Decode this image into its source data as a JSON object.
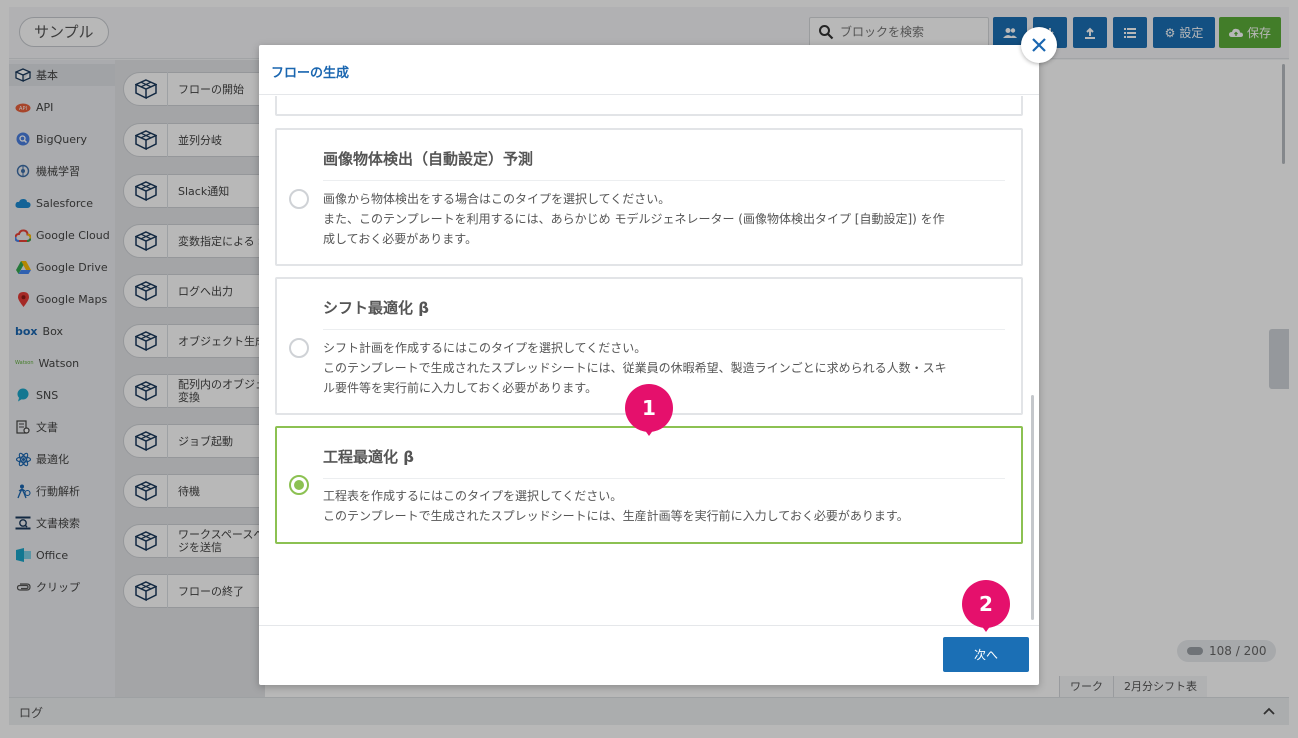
{
  "app": {
    "title": "サンプル"
  },
  "search": {
    "placeholder": "ブロックを検索"
  },
  "toolbar": {
    "settings_label": "設定",
    "save_label": "保存"
  },
  "sidebar": {
    "categories": [
      {
        "label": "基本",
        "icon": "box-icon"
      },
      {
        "label": "API",
        "icon": "api-icon"
      },
      {
        "label": "BigQuery",
        "icon": "bigquery-icon"
      },
      {
        "label": "機械学習",
        "icon": "brain-icon"
      },
      {
        "label": "Salesforce",
        "icon": "salesforce-icon"
      },
      {
        "label": "Google Cloud",
        "icon": "google-cloud-icon"
      },
      {
        "label": "Google Drive",
        "icon": "google-drive-icon"
      },
      {
        "label": "Google Maps",
        "icon": "map-pin-icon"
      },
      {
        "label": "Box",
        "icon": "box-logo-icon",
        "prefix": "box"
      },
      {
        "label": "Watson",
        "icon": "watson-icon",
        "prefix": "Watson"
      },
      {
        "label": "SNS",
        "icon": "chat-icon"
      },
      {
        "label": "文書",
        "icon": "document-icon"
      },
      {
        "label": "最適化",
        "icon": "atom-icon"
      },
      {
        "label": "行動解析",
        "icon": "person-icon"
      },
      {
        "label": "文書検索",
        "icon": "doc-search-icon"
      },
      {
        "label": "Office",
        "icon": "office-icon"
      },
      {
        "label": "クリップ",
        "icon": "clip-icon"
      }
    ]
  },
  "blocks": [
    {
      "line1": "フローの開始",
      "line2": ""
    },
    {
      "line1": "並列分岐",
      "line2": ""
    },
    {
      "line1": "Slack通知",
      "line2": ""
    },
    {
      "line1": "変数指定による S",
      "line2": ""
    },
    {
      "line1": "ログへ出力",
      "line2": ""
    },
    {
      "line1": "オブジェクト生成",
      "line2": ""
    },
    {
      "line1": "配列内のオブジェ",
      "line2": "変換"
    },
    {
      "line1": "ジョブ起動",
      "line2": ""
    },
    {
      "line1": "待機",
      "line2": ""
    },
    {
      "line1": "ワークスペースへ",
      "line2": "ジを送信"
    },
    {
      "line1": "フローの終了",
      "line2": ""
    }
  ],
  "bottom": {
    "log_label": "ログ",
    "tabs": [
      "ワーク",
      "2月分シフト表"
    ],
    "counter": "108 / 200"
  },
  "modal": {
    "title": "フローの生成",
    "cards": [
      {
        "title": "画像物体検出（自動設定）予測",
        "desc1": "画像から物体検出をする場合はこのタイプを選択してください。",
        "desc2": "また、このテンプレートを利用するには、あらかじめ モデルジェネレーター (画像物体検出タイプ [自動設定]) を作",
        "desc3": "成しておく必要があります。",
        "selected": false
      },
      {
        "title": "シフト最適化 β",
        "desc1": "シフト計画を作成するにはこのタイプを選択してください。",
        "desc2": "このテンプレートで生成されたスプレッドシートには、従業員の休暇希望、製造ラインごとに求められる人数・スキ",
        "desc3": "ル要件等を実行前に入力しておく必要があります。",
        "selected": false
      },
      {
        "title": "工程最適化 β",
        "desc1": "工程表を作成するにはこのタイプを選択してください。",
        "desc2": "このテンプレートで生成されたスプレッドシートには、生産計画等を実行前に入力しておく必要があります。",
        "desc3": "",
        "selected": true
      }
    ],
    "next_label": "次へ"
  },
  "markers": [
    "1",
    "2"
  ],
  "colors": {
    "primary": "#1b6fb5",
    "save": "#5cae3a",
    "selected": "#8cc152",
    "marker": "#e5106c",
    "title": "#1a66b0"
  }
}
